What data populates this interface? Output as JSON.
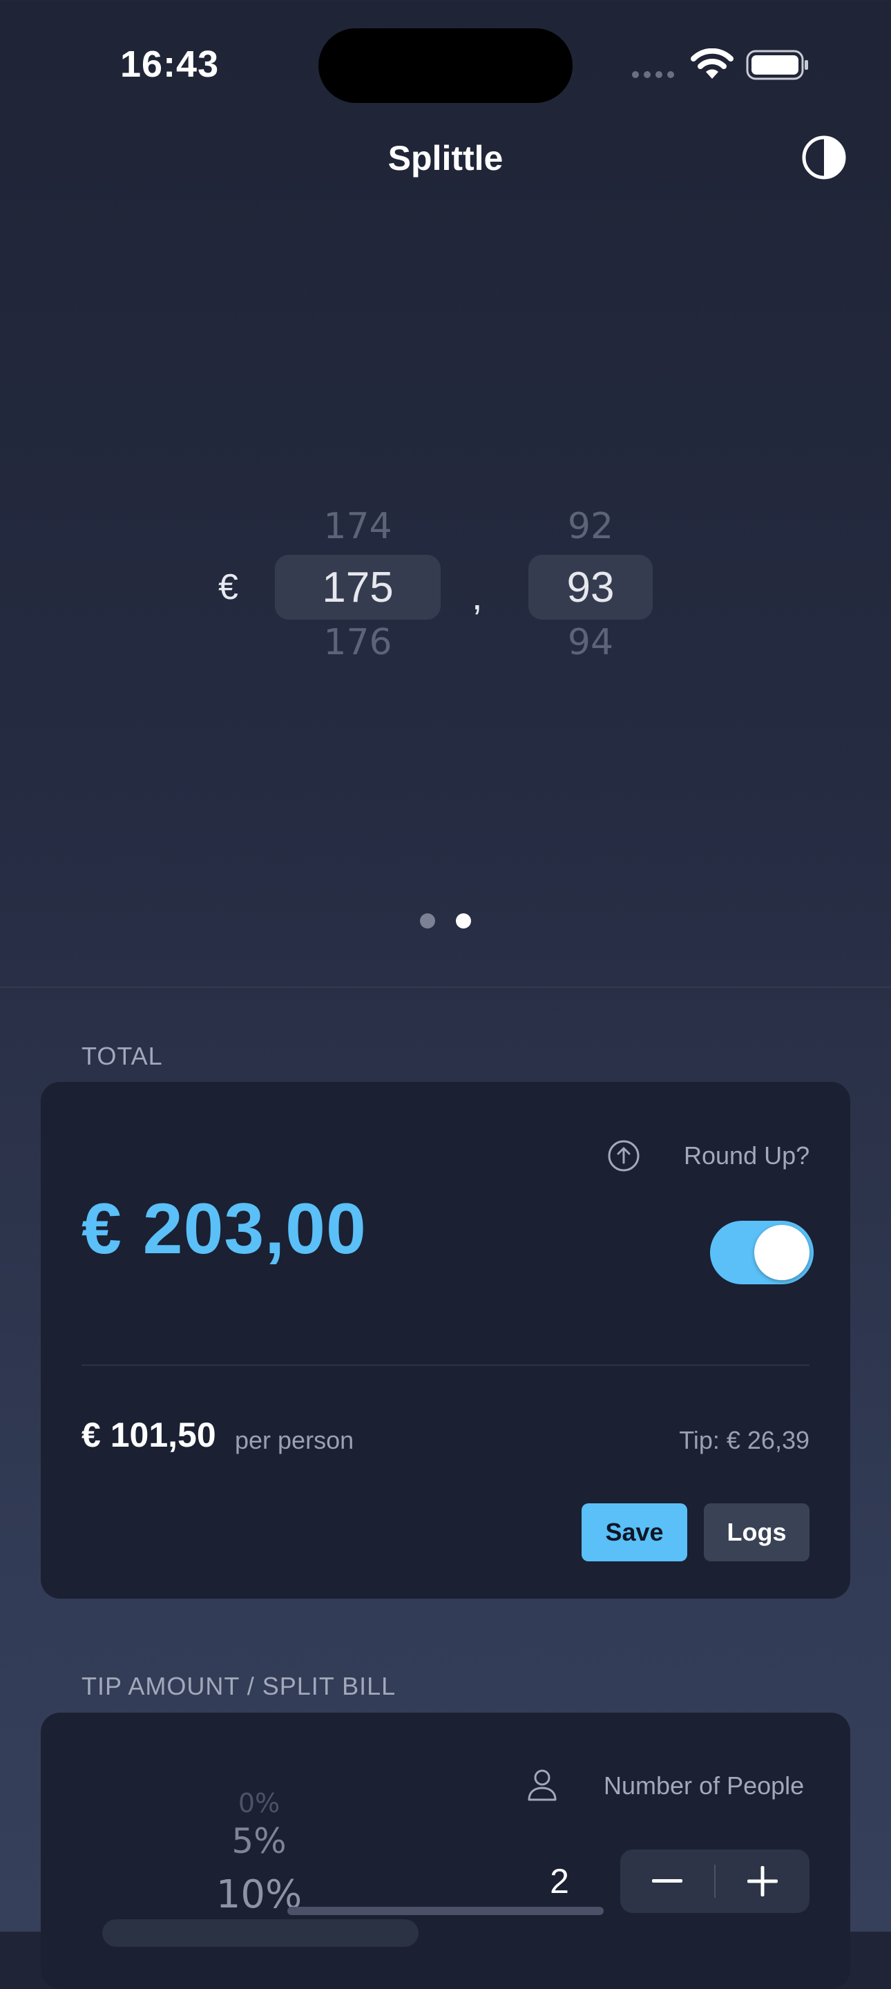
{
  "status_bar": {
    "time": "16:43"
  },
  "header": {
    "title": "Splittle",
    "theme_icon": "contrast-icon"
  },
  "bill_picker": {
    "currency": "€",
    "whole": {
      "above": "174",
      "selected": "175",
      "below": "176"
    },
    "separator": ",",
    "cents": {
      "above": "92",
      "selected": "93",
      "below": "94"
    }
  },
  "pager": {
    "pages": 2,
    "current": 2
  },
  "total_section": {
    "label": "TOTAL",
    "amount": "€ 203,00",
    "round_up_label": "Round Up?",
    "round_up_on": true,
    "per_person_amount": "€ 101,50",
    "per_person_label": "per person",
    "tip_text": "Tip: € 26,39",
    "save_label": "Save",
    "logs_label": "Logs"
  },
  "tip_section": {
    "label": "TIP AMOUNT / SPLIT BILL",
    "tip_options": [
      "0%",
      "5%",
      "10%"
    ],
    "people_label": "Number of People",
    "people_count": "2",
    "minus_label": "−",
    "plus_label": "+"
  },
  "colors": {
    "accent": "#5ac0f7",
    "card": "#1b2033"
  }
}
